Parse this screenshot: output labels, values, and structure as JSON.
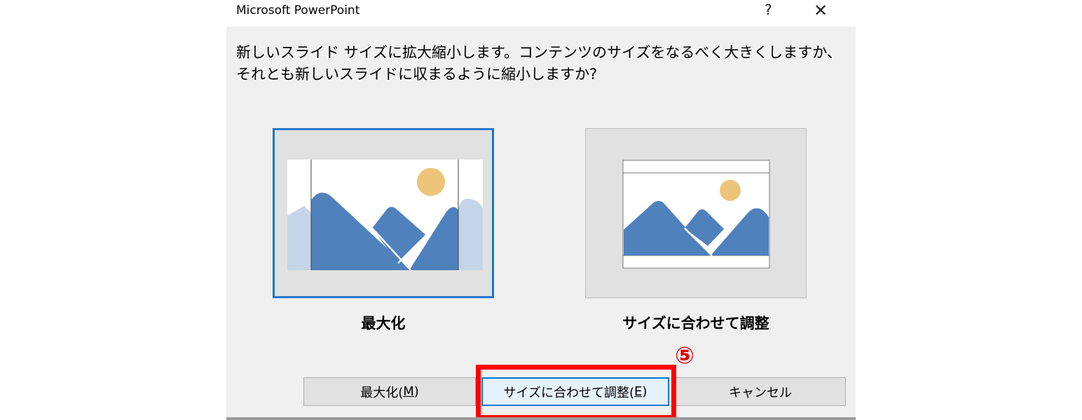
{
  "window": {
    "title": "Microsoft PowerPoint",
    "help_glyph": "?",
    "close_glyph": "✕"
  },
  "message": {
    "line1": "新しいスライド サイズに拡大縮小します。コンテンツのサイズをなるべく大きくしますか、",
    "line2": "それとも新しいスライドに収まるように縮小しますか?"
  },
  "options": {
    "maximize_label": "最大化",
    "fit_label": "サイズに合わせて調整"
  },
  "annotation": {
    "step_marker": "⑤",
    "marker_color": "#ff0000"
  },
  "buttons": {
    "maximize": {
      "text": "最大化(",
      "key": "M",
      "end": ")"
    },
    "fit": {
      "text": "サイズに合わせて調整(",
      "key": "E",
      "end": ")"
    },
    "cancel": {
      "text": "キャンセル"
    }
  },
  "colors": {
    "accent": "#1979ca",
    "mountain": "#4f81bd",
    "sun": "#ecc47a",
    "faded_mountain": "#c5d5e8"
  }
}
